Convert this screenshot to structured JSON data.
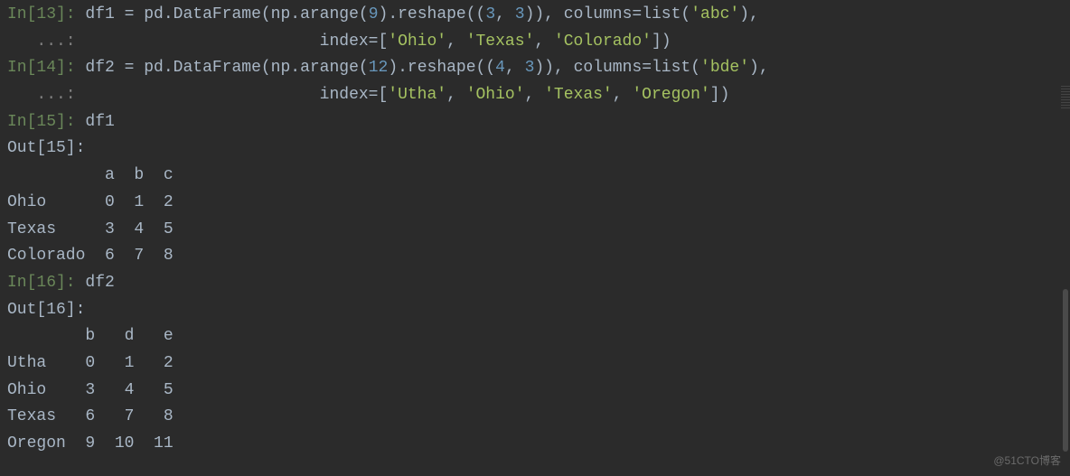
{
  "cells": {
    "in13": {
      "prompt": "In[13]:",
      "contPrompt": "   ...:",
      "code1a": " df1 ",
      "code1b": " pd.DataFrame(np.arange(",
      "num9": "9",
      "code1c": ").reshape((",
      "num3a": "3",
      "code1d": ", ",
      "num3b": "3",
      "code1e": ")), columns=list(",
      "strAbc": "'abc'",
      "code1f": "),",
      "code2a": "                         index=[",
      "strOhio": "'Ohio'",
      "code2b": ", ",
      "strTexas": "'Texas'",
      "code2c": ", ",
      "strColorado": "'Colorado'",
      "code2d": "])"
    },
    "in14": {
      "prompt": "In[14]:",
      "contPrompt": "   ...:",
      "code1a": " df2 ",
      "code1b": " pd.DataFrame(np.arange(",
      "num12": "12",
      "code1c": ").reshape((",
      "num4": "4",
      "code1d": ", ",
      "num3": "3",
      "code1e": ")), columns=list(",
      "strBde": "'bde'",
      "code1f": "),",
      "code2a": "                         index=[",
      "strUtha": "'Utha'",
      "code2b": ", ",
      "strOhio": "'Ohio'",
      "code2c": ", ",
      "strTexas": "'Texas'",
      "code2d": ", ",
      "strOregon": "'Oregon'",
      "code2e": "])"
    },
    "in15": {
      "prompt": "In[15]:",
      "code": " df1"
    },
    "out15": {
      "prompt": "Out[15]:",
      "header": "          a  b  c",
      "rows": [
        "Ohio      0  1  2",
        "Texas     3  4  5",
        "Colorado  6  7  8"
      ]
    },
    "in16": {
      "prompt": "In[16]:",
      "code": " df2"
    },
    "out16": {
      "prompt": "Out[16]:",
      "header": "        b   d   e",
      "rows": [
        "Utha    0   1   2",
        "Ohio    3   4   5",
        "Texas   6   7   8",
        "Oregon  9  10  11"
      ]
    }
  },
  "eq": "=",
  "watermark": "@51CTO博客",
  "chart_data": {
    "type": "table",
    "tables": [
      {
        "name": "df1",
        "columns": [
          "a",
          "b",
          "c"
        ],
        "index": [
          "Ohio",
          "Texas",
          "Colorado"
        ],
        "data": [
          [
            0,
            1,
            2
          ],
          [
            3,
            4,
            5
          ],
          [
            6,
            7,
            8
          ]
        ]
      },
      {
        "name": "df2",
        "columns": [
          "b",
          "d",
          "e"
        ],
        "index": [
          "Utha",
          "Ohio",
          "Texas",
          "Oregon"
        ],
        "data": [
          [
            0,
            1,
            2
          ],
          [
            3,
            4,
            5
          ],
          [
            6,
            7,
            8
          ],
          [
            9,
            10,
            11
          ]
        ]
      }
    ]
  }
}
